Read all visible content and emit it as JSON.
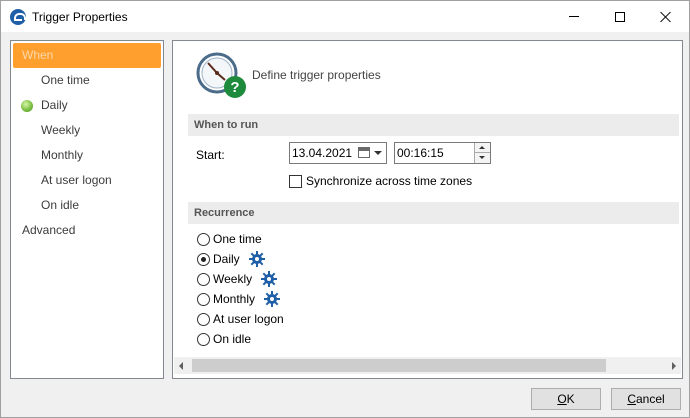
{
  "window": {
    "title": "Trigger Properties"
  },
  "sidebar": {
    "header": "When",
    "items": [
      {
        "label": "One time",
        "active": false
      },
      {
        "label": "Daily",
        "active": true
      },
      {
        "label": "Weekly",
        "active": false
      },
      {
        "label": "Monthly",
        "active": false
      },
      {
        "label": "At user logon",
        "active": false
      },
      {
        "label": "On idle",
        "active": false
      }
    ],
    "advanced": "Advanced"
  },
  "main": {
    "header_text": "Define trigger properties",
    "when_to_run": {
      "title": "When to run",
      "start_label": "Start:",
      "date_value": "13.04.2021",
      "time_value": "00:16:15",
      "sync_label": "Synchronize across time zones",
      "sync_checked": false
    },
    "recurrence": {
      "title": "Recurrence",
      "options": [
        {
          "label": "One time",
          "selected": false,
          "has_settings": false
        },
        {
          "label": "Daily",
          "selected": true,
          "has_settings": true
        },
        {
          "label": "Weekly",
          "selected": false,
          "has_settings": true
        },
        {
          "label": "Monthly",
          "selected": false,
          "has_settings": true
        },
        {
          "label": "At user logon",
          "selected": false,
          "has_settings": false
        },
        {
          "label": "On idle",
          "selected": false,
          "has_settings": false
        }
      ]
    }
  },
  "buttons": {
    "ok_label_underlined": "O",
    "ok_label_rest": "K",
    "cancel_label_underlined": "C",
    "cancel_label_rest": "ancel"
  },
  "colors": {
    "sidebar_header": "#ff9f2e",
    "gear": "#1f5fa8",
    "help_badge": "#1e8a3c"
  }
}
